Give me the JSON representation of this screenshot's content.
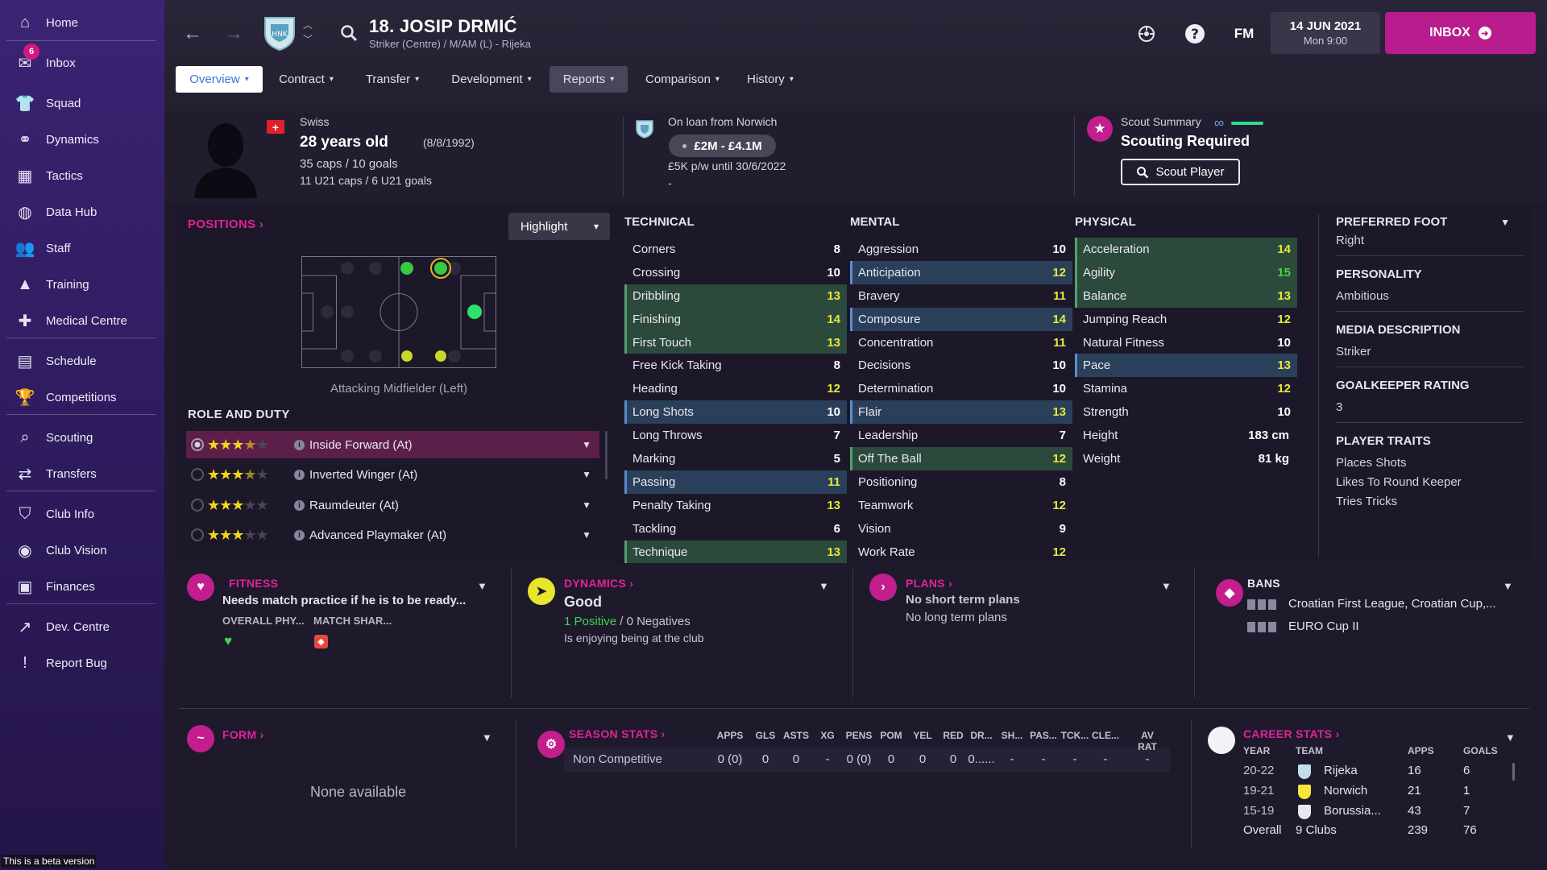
{
  "sidebar": {
    "items": [
      {
        "label": "Home",
        "icon": "home-icon",
        "glyph": "⌂"
      },
      {
        "label": "Inbox",
        "icon": "inbox-icon",
        "glyph": "✉",
        "badge": "6"
      },
      {
        "label": "Squad",
        "icon": "squad-icon",
        "glyph": "👕"
      },
      {
        "label": "Dynamics",
        "icon": "dynamics-icon",
        "glyph": "⚭"
      },
      {
        "label": "Tactics",
        "icon": "tactics-icon",
        "glyph": "▦"
      },
      {
        "label": "Data Hub",
        "icon": "data-hub-icon",
        "glyph": "◍"
      },
      {
        "label": "Staff",
        "icon": "staff-icon",
        "glyph": "👥"
      },
      {
        "label": "Training",
        "icon": "training-icon",
        "glyph": "▲"
      },
      {
        "label": "Medical Centre",
        "icon": "medical-icon",
        "glyph": "✚"
      },
      {
        "label": "Schedule",
        "icon": "schedule-icon",
        "glyph": "▤"
      },
      {
        "label": "Competitions",
        "icon": "trophy-icon",
        "glyph": "🏆"
      },
      {
        "label": "Scouting",
        "icon": "scouting-icon",
        "glyph": "⌕"
      },
      {
        "label": "Transfers",
        "icon": "transfers-icon",
        "glyph": "⇄"
      },
      {
        "label": "Club Info",
        "icon": "shield-icon",
        "glyph": "⛉"
      },
      {
        "label": "Club Vision",
        "icon": "vision-icon",
        "glyph": "◉"
      },
      {
        "label": "Finances",
        "icon": "finances-icon",
        "glyph": "▣"
      },
      {
        "label": "Dev. Centre",
        "icon": "dev-centre-icon",
        "glyph": "↗"
      },
      {
        "label": "Report Bug",
        "icon": "bug-icon",
        "glyph": "!"
      }
    ],
    "beta_text": "This is a beta version"
  },
  "header": {
    "player_name": "18. JOSIP DRMIĆ",
    "player_sub": "Striker (Centre) / M/AM (L) - Rijeka",
    "fm_label": "FM",
    "date": "14 JUN 2021",
    "time": "Mon 9:00",
    "inbox_label": "INBOX"
  },
  "tabs": [
    {
      "label": "Overview"
    },
    {
      "label": "Contract"
    },
    {
      "label": "Transfer"
    },
    {
      "label": "Development"
    },
    {
      "label": "Reports"
    },
    {
      "label": "Comparison"
    },
    {
      "label": "History"
    }
  ],
  "player": {
    "nationality": "Swiss",
    "age": "28 years old",
    "dob": "(8/8/1992)",
    "caps": "35 caps / 10 goals",
    "u21": "11 U21 caps / 6 U21 goals"
  },
  "loan": {
    "text": "On loan from Norwich",
    "value": "£2M - £4.1M",
    "wage": "£5K p/w until 30/6/2022",
    "extra": "-"
  },
  "scout": {
    "label": "Scout Summary",
    "status": "Scouting Required",
    "button": "Scout Player"
  },
  "positions": {
    "title": "POSITIONS",
    "highlight_label": "Highlight",
    "caption": "Attacking Midfielder (Left)",
    "role_title": "ROLE AND DUTY",
    "roles": [
      {
        "label": "Inside Forward (At)",
        "stars": 3.5
      },
      {
        "label": "Inverted Winger (At)",
        "stars": 3.5
      },
      {
        "label": "Raumdeuter (At)",
        "stars": 3
      },
      {
        "label": "Advanced Playmaker (At)",
        "stars": 3
      }
    ]
  },
  "attributes": {
    "technical_title": "TECHNICAL",
    "mental_title": "MENTAL",
    "physical_title": "PHYSICAL",
    "technical": [
      {
        "name": "Corners",
        "value": "8"
      },
      {
        "name": "Crossing",
        "value": "10"
      },
      {
        "name": "Dribbling",
        "value": "13",
        "hl": "green"
      },
      {
        "name": "Finishing",
        "value": "14",
        "hl": "green"
      },
      {
        "name": "First Touch",
        "value": "13",
        "hl": "green"
      },
      {
        "name": "Free Kick Taking",
        "value": "8"
      },
      {
        "name": "Heading",
        "value": "12"
      },
      {
        "name": "Long Shots",
        "value": "10",
        "hl": "blue"
      },
      {
        "name": "Long Throws",
        "value": "7"
      },
      {
        "name": "Marking",
        "value": "5"
      },
      {
        "name": "Passing",
        "value": "11",
        "hl": "blue"
      },
      {
        "name": "Penalty Taking",
        "value": "13"
      },
      {
        "name": "Tackling",
        "value": "6"
      },
      {
        "name": "Technique",
        "value": "13",
        "hl": "green"
      }
    ],
    "mental": [
      {
        "name": "Aggression",
        "value": "10"
      },
      {
        "name": "Anticipation",
        "value": "12",
        "hl": "blue"
      },
      {
        "name": "Bravery",
        "value": "11"
      },
      {
        "name": "Composure",
        "value": "14",
        "hl": "blue"
      },
      {
        "name": "Concentration",
        "value": "11"
      },
      {
        "name": "Decisions",
        "value": "10"
      },
      {
        "name": "Determination",
        "value": "10"
      },
      {
        "name": "Flair",
        "value": "13",
        "hl": "blue"
      },
      {
        "name": "Leadership",
        "value": "7"
      },
      {
        "name": "Off The Ball",
        "value": "12",
        "hl": "green"
      },
      {
        "name": "Positioning",
        "value": "8"
      },
      {
        "name": "Teamwork",
        "value": "12"
      },
      {
        "name": "Vision",
        "value": "9"
      },
      {
        "name": "Work Rate",
        "value": "12"
      }
    ],
    "physical": [
      {
        "name": "Acceleration",
        "value": "14",
        "hl": "green"
      },
      {
        "name": "Agility",
        "value": "15",
        "hl": "green"
      },
      {
        "name": "Balance",
        "value": "13",
        "hl": "green"
      },
      {
        "name": "Jumping Reach",
        "value": "12"
      },
      {
        "name": "Natural Fitness",
        "value": "10"
      },
      {
        "name": "Pace",
        "value": "13",
        "hl": "blue"
      },
      {
        "name": "Stamina",
        "value": "12"
      },
      {
        "name": "Strength",
        "value": "10"
      }
    ],
    "height_label": "Height",
    "height": "183 cm",
    "weight_label": "Weight",
    "weight": "81 kg"
  },
  "info": {
    "foot_h": "PREFERRED FOOT",
    "foot_v": "Right",
    "personality_h": "PERSONALITY",
    "personality_v": "Ambitious",
    "media_h": "MEDIA DESCRIPTION",
    "media_v": "Striker",
    "gk_h": "GOALKEEPER RATING",
    "gk_v": "3",
    "traits_h": "PLAYER TRAITS",
    "traits": [
      "Places Shots",
      "Likes To Round Keeper",
      "Tries Tricks"
    ]
  },
  "fitness": {
    "title": "FITNESS",
    "text": "Needs match practice if he is to be ready...",
    "overall_label": "OVERALL PHY...",
    "match_label": "MATCH SHAR..."
  },
  "dynamics": {
    "title": "DYNAMICS",
    "status": "Good",
    "positive": "1 Positive",
    "sep": "/",
    "negative": "0 Negatives",
    "note": "Is enjoying being at the club"
  },
  "plans": {
    "title": "PLANS",
    "short": "No short term plans",
    "long": "No long term plans"
  },
  "bans": {
    "title": "BANS",
    "items": [
      "Croatian First League, Croatian Cup,...",
      "EURO Cup II"
    ]
  },
  "form": {
    "title": "FORM",
    "empty": "None available"
  },
  "season_stats": {
    "title": "SEASON STATS",
    "headers": [
      "APPS",
      "GLS",
      "ASTS",
      "XG",
      "PENS",
      "POM",
      "YEL",
      "RED",
      "DR...",
      "SH...",
      "PAS...",
      "TCK...",
      "CLE...",
      "AV RAT"
    ],
    "row_label": "Non Competitive",
    "values": [
      "0 (0)",
      "0",
      "0",
      "-",
      "0 (0)",
      "0",
      "0",
      "0",
      "0......",
      "-",
      "-",
      "-",
      "-",
      "-"
    ]
  },
  "career_stats": {
    "title": "CAREER STATS",
    "headers": {
      "year": "YEAR",
      "team": "TEAM",
      "apps": "APPS",
      "goals": "GOALS"
    },
    "rows": [
      {
        "year": "20-22",
        "team": "Rijeka",
        "apps": "16",
        "goals": "6"
      },
      {
        "year": "19-21",
        "team": "Norwich",
        "apps": "21",
        "goals": "1"
      },
      {
        "year": "15-19",
        "team": "Borussia...",
        "apps": "43",
        "goals": "7"
      }
    ],
    "overall_label": "Overall",
    "overall_clubs": "9 Clubs",
    "overall_apps": "239",
    "overall_goals": "76"
  }
}
